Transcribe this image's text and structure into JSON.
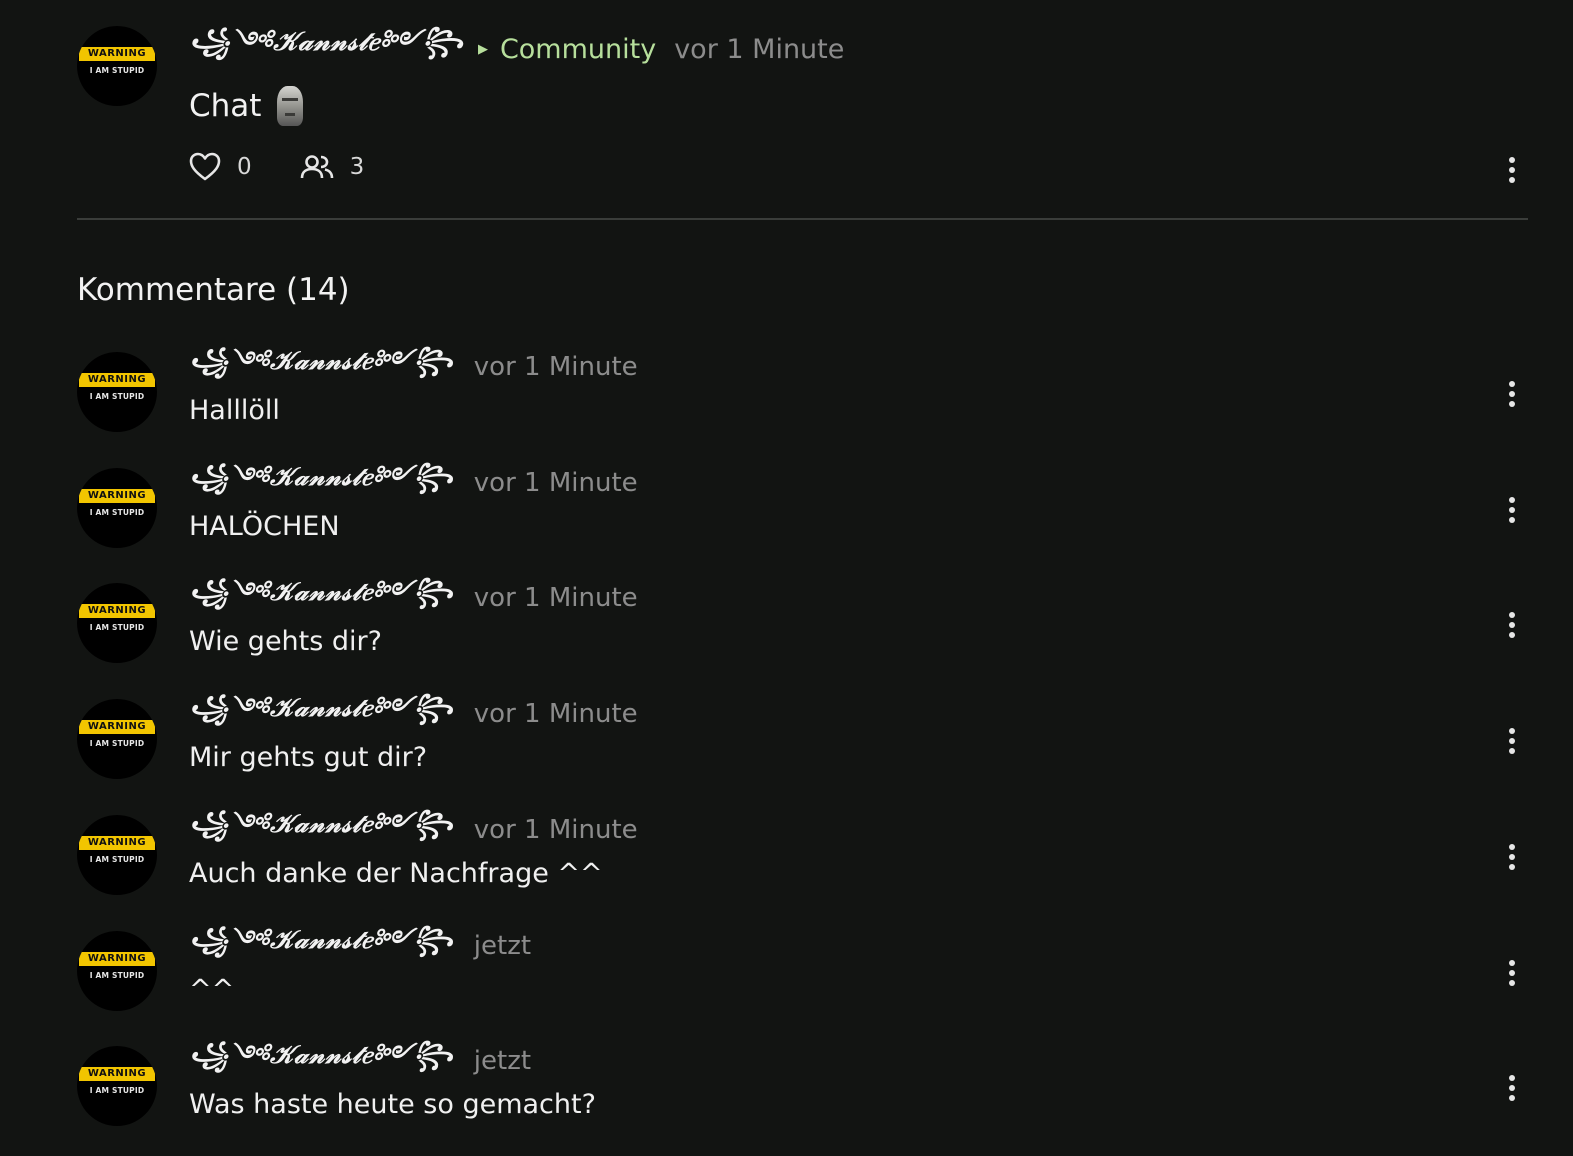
{
  "post": {
    "author": "꧁༺𝒦𝒶𝓃𝓃𝓈𝓉𝑒༻꧂",
    "community": "Community",
    "time": "vor 1 Minute",
    "title": "Chat",
    "title_emoji_icon": "moai-icon",
    "likes": "0",
    "participants": "3",
    "avatar": {
      "warning": "WARNING",
      "sub": "I AM STUPID",
      "band_color": "#f2c500"
    }
  },
  "comments_title": "Kommentare (14)",
  "comments": [
    {
      "author": "꧁༺𝒦𝒶𝓃𝓃𝓈𝓉𝑒༻꧂",
      "time": "vor 1 Minute",
      "text": "Halllöll"
    },
    {
      "author": "꧁༺𝒦𝒶𝓃𝓃𝓈𝓉𝑒༻꧂",
      "time": "vor 1 Minute",
      "text": "HALÖCHEN"
    },
    {
      "author": "꧁༺𝒦𝒶𝓃𝓃𝓈𝓉𝑒༻꧂",
      "time": "vor 1 Minute",
      "text": "Wie gehts dir?"
    },
    {
      "author": "꧁༺𝒦𝒶𝓃𝓃𝓈𝓉𝑒༻꧂",
      "time": "vor 1 Minute",
      "text": "Mir gehts gut dir?"
    },
    {
      "author": "꧁༺𝒦𝒶𝓃𝓃𝓈𝓉𝑒༻꧂",
      "time": "vor 1 Minute",
      "text": "Auch danke der Nachfrage ^^"
    },
    {
      "author": "꧁༺𝒦𝒶𝓃𝓃𝓈𝓉𝑒༻꧂",
      "time": "jetzt",
      "text": "^^"
    },
    {
      "author": "꧁༺𝒦𝒶𝓃𝓃𝓈𝓉𝑒༻꧂",
      "time": "jetzt",
      "text": "Was haste heute so gemacht?"
    }
  ],
  "colors": {
    "background": "#121412",
    "accent": "#b7df9c",
    "muted": "#8c8c8c",
    "divider": "#3a3d3a"
  }
}
